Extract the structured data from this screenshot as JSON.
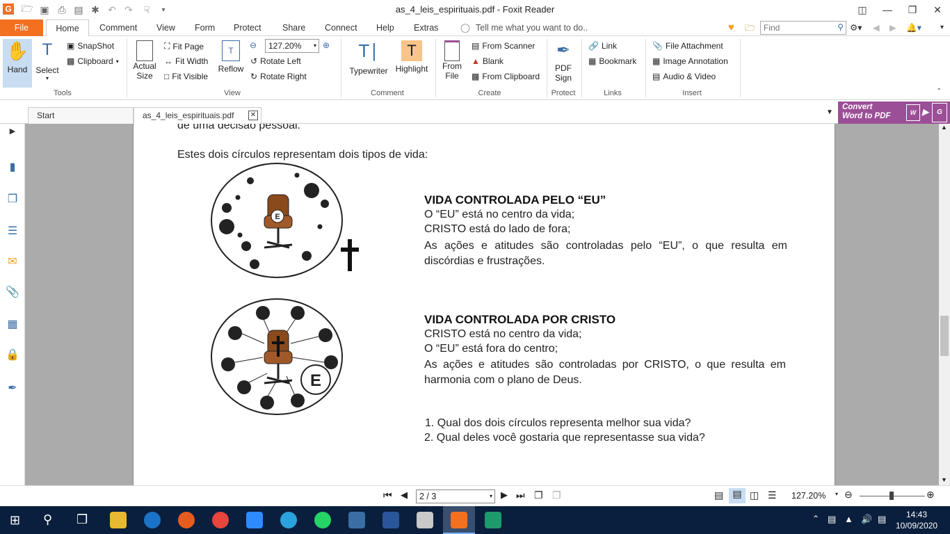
{
  "window": {
    "title": "as_4_leis_espirituais.pdf - Foxit Reader"
  },
  "menu": {
    "file": "File",
    "home": "Home",
    "comment": "Comment",
    "view": "View",
    "form": "Form",
    "protect": "Protect",
    "share": "Share",
    "connect": "Connect",
    "help": "Help",
    "extras": "Extras",
    "tell_me": "Tell me what you want to do..",
    "find_placeholder": "Find"
  },
  "ribbon": {
    "tools": {
      "hand": "Hand",
      "select": "Select",
      "snapshot": "SnapShot",
      "clipboard": "Clipboard",
      "label": "Tools"
    },
    "view": {
      "actual": "Actual",
      "size": "Size",
      "fit_page": "Fit Page",
      "fit_width": "Fit Width",
      "fit_visible": "Fit Visible",
      "reflow": "Reflow",
      "zoom": "127.20%",
      "rotate_left": "Rotate Left",
      "rotate_right": "Rotate Right",
      "label": "View"
    },
    "comment": {
      "typewriter": "Typewriter",
      "highlight": "Highlight",
      "label": "Comment"
    },
    "create": {
      "from": "From",
      "file": "File",
      "from_scanner": "From Scanner",
      "blank": "Blank",
      "from_clipboard": "From Clipboard",
      "label": "Create"
    },
    "protect": {
      "pdf": "PDF",
      "sign": "Sign",
      "label": "Protect"
    },
    "links": {
      "link": "Link",
      "bookmark": "Bookmark",
      "label": "Links"
    },
    "insert": {
      "file_attachment": "File Attachment",
      "image_annotation": "Image Annotation",
      "audio_video": "Audio & Video",
      "label": "Insert"
    }
  },
  "tabs": {
    "start": "Start",
    "doc": "as_4_leis_espirituais.pdf"
  },
  "convert": {
    "line1": "Convert",
    "line2": "Word to PDF"
  },
  "document": {
    "top_cut": "de uma decisão pessoal.",
    "intro": "Estes dois círculos representam dois tipos de vida:",
    "circle1_label": "E",
    "circle2_label": "E",
    "block1": {
      "heading": "VIDA CONTROLADA PELO “EU”",
      "l1": "O “EU” está no centro da vida;",
      "l2": "CRISTO está do lado de fora;",
      "l3": "As ações e atitudes são controladas pelo “EU”, o que resulta em discórdias e frustrações."
    },
    "block2": {
      "heading": "VIDA CONTROLADA POR CRISTO",
      "l1": "CRISTO está no centro da vida;",
      "l2": "O “EU” está fora do centro;",
      "l3": "As ações e atitudes são controladas por CRISTO, o que resulta em harmonia com o plano de Deus."
    },
    "q1": "1. Qual dos dois círculos representa melhor sua vida?",
    "q2": "2. Qual deles você gostaria que representasse sua vida?"
  },
  "status": {
    "page": "2 / 3",
    "zoom": "127.20%"
  },
  "taskbar": {
    "time": "14:43",
    "date": "10/09/2020"
  },
  "colors": {
    "accent": "#f37021",
    "chair": "#8b4a1c",
    "convert": "#9b4f96",
    "taskbar": "#0a1f3d"
  }
}
